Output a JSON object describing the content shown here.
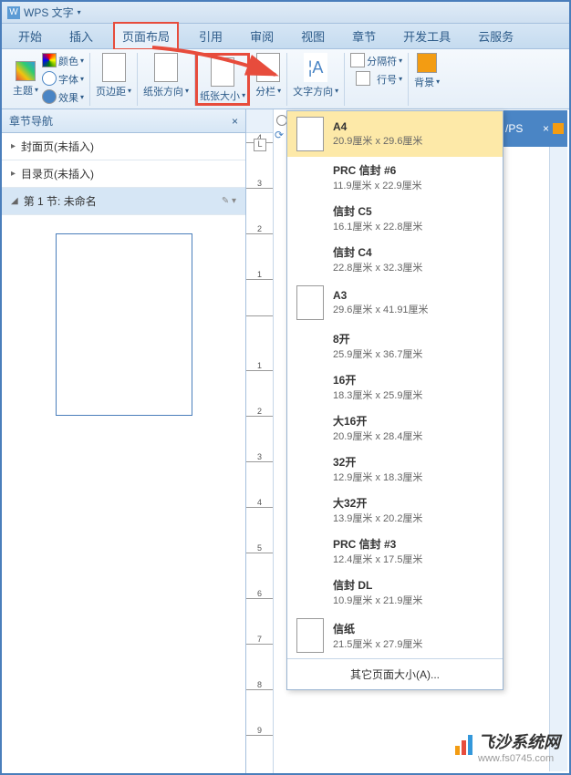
{
  "titleBar": {
    "app": "WPS 文字"
  },
  "menu": {
    "items": [
      "开始",
      "插入",
      "页面布局",
      "引用",
      "审阅",
      "视图",
      "章节",
      "开发工具",
      "云服务"
    ],
    "active": 2
  },
  "ribbon": {
    "theme": "主题",
    "color": "颜色",
    "font": "字体",
    "effect": "效果",
    "margin": "页边距",
    "orientation": "纸张方向",
    "size": "纸张大小",
    "columns": "分栏",
    "textDir": "文字方向",
    "breaks": "分隔符",
    "lineNum": "行号",
    "background": "背景"
  },
  "sidebar": {
    "title": "章节导航",
    "items": [
      {
        "label": "封面页(未插入)",
        "toggle": "▸"
      },
      {
        "label": "目录页(未插入)",
        "toggle": "▸"
      },
      {
        "label": "第 1 节: 未命名",
        "toggle": "◢",
        "active": true
      }
    ]
  },
  "rulerTicks": [
    "4",
    "3",
    "2",
    "1",
    "",
    "1",
    "2",
    "3",
    "4",
    "5",
    "6",
    "7",
    "8",
    "9"
  ],
  "paperSizes": [
    {
      "name": "A4",
      "dim": "20.9厘米 x 29.6厘米",
      "selected": true,
      "icon": true
    },
    {
      "name": "PRC 信封 #6",
      "dim": "11.9厘米 x 22.9厘米"
    },
    {
      "name": "信封 C5",
      "dim": "16.1厘米 x 22.8厘米"
    },
    {
      "name": "信封 C4",
      "dim": "22.8厘米 x 32.3厘米"
    },
    {
      "name": "A3",
      "dim": "29.6厘米 x 41.91厘米",
      "icon": true
    },
    {
      "name": "8开",
      "dim": "25.9厘米 x 36.7厘米"
    },
    {
      "name": "16开",
      "dim": "18.3厘米 x 25.9厘米"
    },
    {
      "name": "大16开",
      "dim": "20.9厘米 x 28.4厘米"
    },
    {
      "name": "32开",
      "dim": "12.9厘米 x 18.3厘米"
    },
    {
      "name": "大32开",
      "dim": "13.9厘米 x 20.2厘米"
    },
    {
      "name": "PRC 信封 #3",
      "dim": "12.4厘米 x 17.5厘米"
    },
    {
      "name": "信封 DL",
      "dim": "10.9厘米 x 21.9厘米"
    },
    {
      "name": "信纸",
      "dim": "21.5厘米 x 27.9厘米",
      "icon": true
    }
  ],
  "moreSizes": "其它页面大小(A)...",
  "rightTab": "/PS",
  "watermark": {
    "cn": "飞沙系统网",
    "url": "www.fs0745.com"
  }
}
